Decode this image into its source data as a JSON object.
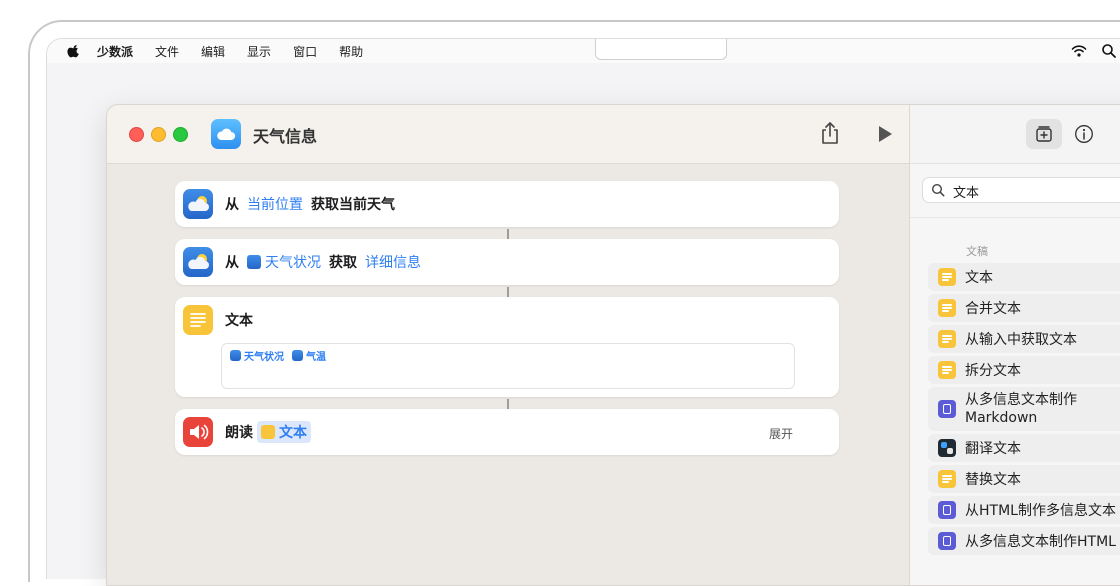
{
  "menubar": {
    "items": [
      "少数派",
      "文件",
      "编辑",
      "显示",
      "窗口",
      "帮助"
    ]
  },
  "window": {
    "title": "天气信息"
  },
  "actions": [
    {
      "prefix": "从",
      "param": "当前位置",
      "suffix": "获取当前天气"
    },
    {
      "prefix": "从",
      "param": "天气状况",
      "middle": "获取",
      "param2": "详细信息"
    },
    {
      "title": "文本",
      "tokens": [
        "天气状况",
        "气温"
      ]
    },
    {
      "prefix": "朗读",
      "param": "文本",
      "expand": "展开"
    }
  ],
  "sidebar": {
    "search_value": "文本",
    "section": "文稿",
    "items": [
      {
        "label": "文本",
        "icon": "text-icon"
      },
      {
        "label": "合并文本",
        "icon": "text-icon"
      },
      {
        "label": "从输入中获取文本",
        "icon": "text-icon"
      },
      {
        "label": "拆分文本",
        "icon": "text-icon"
      },
      {
        "label": "从多信息文本制作 Markdown",
        "icon": "document-icon"
      },
      {
        "label": "翻译文本",
        "icon": "translate-icon"
      },
      {
        "label": "替换文本",
        "icon": "text-icon"
      },
      {
        "label": "从HTML制作多信息文本",
        "icon": "document-icon"
      },
      {
        "label": "从多信息文本制作HTML",
        "icon": "document-icon"
      }
    ]
  },
  "colors": {
    "accent": "#2f7ff2",
    "close": "#ff5f57",
    "minimize": "#febc2e",
    "zoom": "#28c840"
  }
}
